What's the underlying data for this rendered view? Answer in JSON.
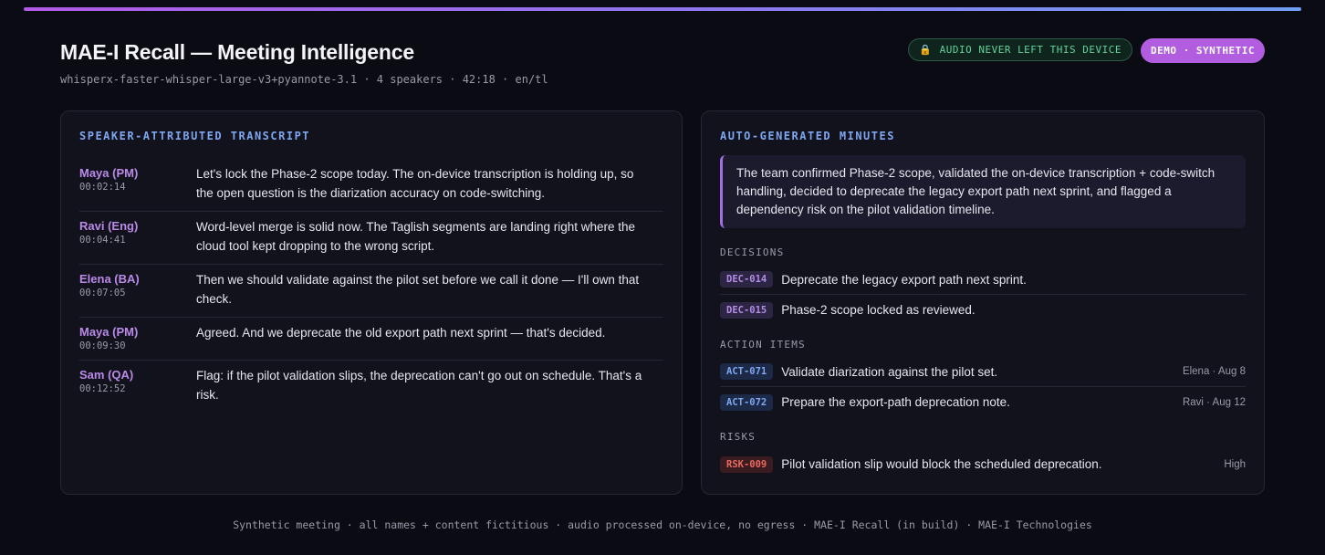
{
  "header": {
    "title": "MAE-I Recall — Meeting Intelligence",
    "subtitle": "whisperx-faster-whisper-large-v3+pyannote-3.1 · 4 speakers · 42:18 · en/tl",
    "privacy_badge": "AUDIO NEVER LEFT THIS DEVICE",
    "privacy_icon": "lock-icon",
    "demo_badge": "DEMO · SYNTHETIC"
  },
  "transcript": {
    "heading": "SPEAKER-ATTRIBUTED TRANSCRIPT",
    "turns": [
      {
        "speaker": "Maya (PM)",
        "time": "00:02:14",
        "text": "Let's lock the Phase-2 scope today. The on-device transcription is holding up, so the open question is the diarization accuracy on code-switching."
      },
      {
        "speaker": "Ravi (Eng)",
        "time": "00:04:41",
        "text": "Word-level merge is solid now. The Taglish segments are landing right where the cloud tool kept dropping to the wrong script."
      },
      {
        "speaker": "Elena (BA)",
        "time": "00:07:05",
        "text": "Then we should validate against the pilot set before we call it done — I'll own that check."
      },
      {
        "speaker": "Maya (PM)",
        "time": "00:09:30",
        "text": "Agreed. And we deprecate the old export path next sprint — that's decided."
      },
      {
        "speaker": "Sam (QA)",
        "time": "00:12:52",
        "text": "Flag: if the pilot validation slips, the deprecation can't go out on schedule. That's a risk."
      }
    ]
  },
  "minutes": {
    "heading": "AUTO-GENERATED MINUTES",
    "summary": "The team confirmed Phase-2 scope, validated the on-device transcription + code-switch handling, decided to deprecate the legacy export path next sprint, and flagged a dependency risk on the pilot validation timeline.",
    "decisions_label": "DECISIONS",
    "decisions": [
      {
        "id": "DEC-014",
        "text": "Deprecate the legacy export path next sprint."
      },
      {
        "id": "DEC-015",
        "text": "Phase-2 scope locked as reviewed."
      }
    ],
    "actions_label": "ACTION ITEMS",
    "actions": [
      {
        "id": "ACT-071",
        "text": "Validate diarization against the pilot set.",
        "meta": "Elena · Aug 8"
      },
      {
        "id": "ACT-072",
        "text": "Prepare the export-path deprecation note.",
        "meta": "Ravi · Aug 12"
      }
    ],
    "risks_label": "RISKS",
    "risks": [
      {
        "id": "RSK-009",
        "text": "Pilot validation slip would block the scheduled deprecation.",
        "meta": "High"
      }
    ]
  },
  "footer": "Synthetic meeting · all names + content fictitious · audio processed on-device, no egress · MAE-I Recall (in build) · MAE-I Technologies",
  "colors": {
    "accent_purple": "#b25de0",
    "accent_blue": "#7fa6f0",
    "privacy_green": "#5fd49b",
    "risk_red": "#e86a60"
  }
}
